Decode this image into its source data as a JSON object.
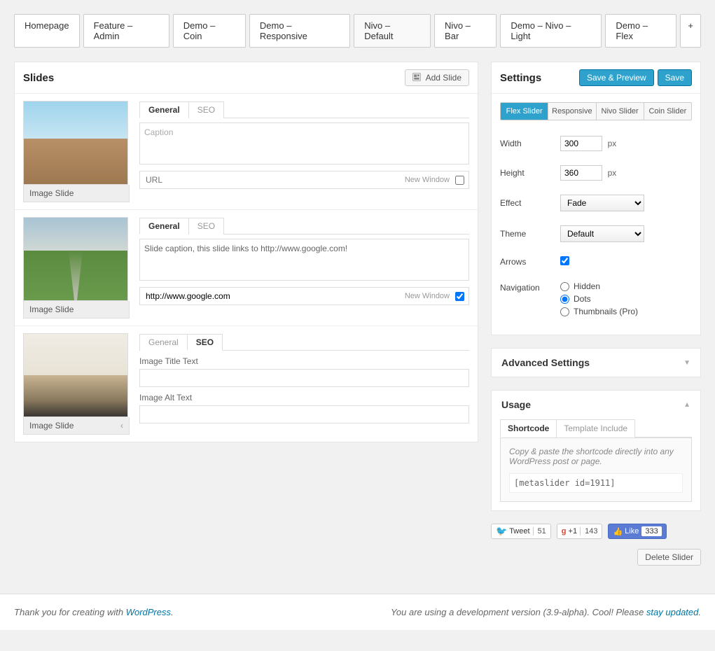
{
  "tabs": [
    "Homepage",
    "Feature – Admin",
    "Demo – Coin",
    "Demo – Responsive",
    "Nivo – Default",
    "Nivo – Bar",
    "Demo – Nivo – Light",
    "Demo – Flex",
    "+"
  ],
  "tabs_active_index": 4,
  "slides_panel": {
    "title": "Slides",
    "add_btn": "Add Slide"
  },
  "slides": [
    {
      "thumb_label": "Image Slide",
      "field_tabs": [
        "General",
        "SEO"
      ],
      "active_tab": 0,
      "caption_placeholder": "Caption",
      "caption": "",
      "url_placeholder": "URL",
      "url": "",
      "new_window_label": "New Window",
      "new_window": false
    },
    {
      "thumb_label": "Image Slide",
      "field_tabs": [
        "General",
        "SEO"
      ],
      "active_tab": 0,
      "caption_placeholder": "Caption",
      "caption": "Slide caption, this slide links to http://www.google.com!",
      "url_placeholder": "URL",
      "url": "http://www.google.com",
      "new_window_label": "New Window",
      "new_window": true
    },
    {
      "thumb_label": "Image Slide",
      "field_tabs": [
        "General",
        "SEO"
      ],
      "active_tab": 1,
      "seo_title_label": "Image Title Text",
      "seo_title": "",
      "seo_alt_label": "Image Alt Text",
      "seo_alt": ""
    }
  ],
  "settings": {
    "title": "Settings",
    "save_preview": "Save & Preview",
    "save": "Save",
    "tabs": [
      "Flex Slider",
      "Responsive",
      "Nivo Slider",
      "Coin Slider"
    ],
    "active_tab": 0,
    "width_label": "Width",
    "width": "300",
    "width_unit": "px",
    "height_label": "Height",
    "height": "360",
    "height_unit": "px",
    "effect_label": "Effect",
    "effect": "Fade",
    "theme_label": "Theme",
    "theme": "Default",
    "arrows_label": "Arrows",
    "arrows": true,
    "nav_label": "Navigation",
    "nav_options": [
      "Hidden",
      "Dots",
      "Thumbnails (Pro)"
    ],
    "nav_selected": "Dots"
  },
  "advanced": {
    "title": "Advanced Settings"
  },
  "usage": {
    "title": "Usage",
    "tabs": [
      "Shortcode",
      "Template Include"
    ],
    "active_tab": 0,
    "hint": "Copy & paste the shortcode directly into any WordPress post or page.",
    "code": "[metaslider id=1911]"
  },
  "social": {
    "tweet_label": "Tweet",
    "tweet_count": "51",
    "gplus_label": "+1",
    "gplus_count": "143",
    "like_label": "Like",
    "like_count": "333"
  },
  "delete_btn": "Delete Slider",
  "footer": {
    "left_pre": "Thank you for creating with ",
    "left_link": "WordPress",
    "left_post": ".",
    "right_pre": "You are using a development version (3.9-alpha). Cool! Please ",
    "right_link": "stay updated",
    "right_post": "."
  }
}
